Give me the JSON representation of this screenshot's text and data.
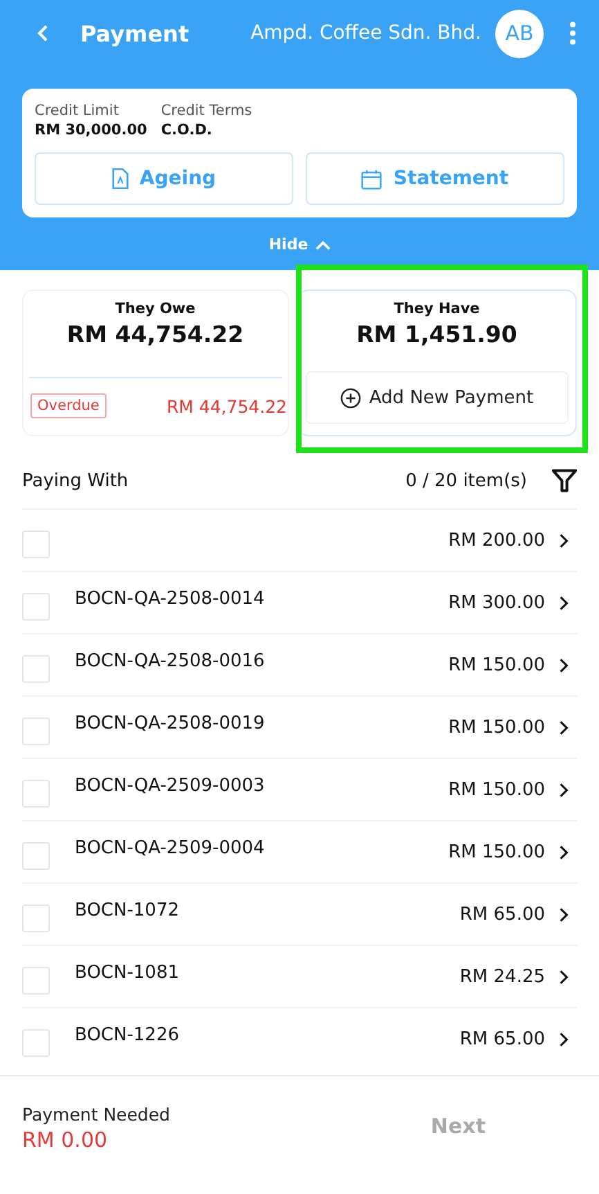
{
  "header": {
    "title": "Payment",
    "company": "Ampd. Coffee Sdn. Bhd.",
    "avatar": "AB"
  },
  "credit": {
    "fields": [
      {
        "label": "Credit Limit",
        "value": "RM 30,000.00"
      },
      {
        "label": "Credit Terms",
        "value": "C.O.D."
      }
    ],
    "buttons": [
      {
        "kind": "ageing",
        "label": "Ageing"
      },
      {
        "kind": "statement",
        "label": "Statement"
      }
    ]
  },
  "collapse": {
    "label": "Hide",
    "expanded": true
  },
  "they_owe": {
    "title": "They Owe",
    "amount": "RM 44,754.22",
    "badge": "Overdue",
    "overdue": "RM 44,754.22"
  },
  "they_have": {
    "title": "They Have",
    "amount": "RM 1,451.90",
    "button": "Add New Payment",
    "highlighted": true
  },
  "paying_with": {
    "label": "Paying With",
    "count": "0 / 20 item(s)"
  },
  "items": [
    {
      "amount": "RM 200.00",
      "checked": false
    },
    {
      "name": "BOCN-QA-2508-0014",
      "amount": "RM 300.00",
      "checked": false
    },
    {
      "name": "BOCN-QA-2508-0016",
      "amount": "RM 150.00",
      "checked": false
    },
    {
      "name": "BOCN-QA-2508-0019",
      "amount": "RM 150.00",
      "checked": false
    },
    {
      "name": "BOCN-QA-2509-0003",
      "amount": "RM 150.00",
      "checked": false
    },
    {
      "name": "BOCN-QA-2509-0004",
      "amount": "RM 150.00",
      "checked": false
    },
    {
      "name": "BOCN-1072",
      "amount": "RM 65.00",
      "checked": false
    },
    {
      "name": "BOCN-1081",
      "amount": "RM 24.25",
      "checked": false
    },
    {
      "name": "BOCN-1226",
      "amount": "RM 65.00",
      "checked": false
    }
  ],
  "footer": {
    "label": "Payment Needed",
    "amount": "RM 0.00",
    "next": "Next",
    "next_disabled": true
  }
}
